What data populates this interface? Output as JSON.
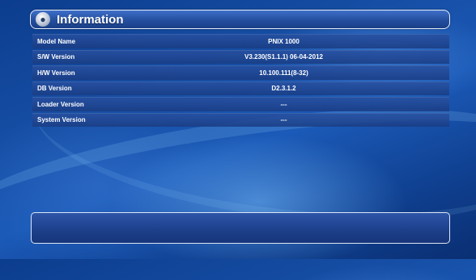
{
  "header": {
    "title": "Information",
    "icon": "info-person-icon"
  },
  "info_rows": [
    {
      "label": "Model Name",
      "value": "PNIX 1000"
    },
    {
      "label": "S/W Version",
      "value": "V3.230(S1.1.1)  06-04-2012"
    },
    {
      "label": "H/W Version",
      "value": "10.100.111(8-32)"
    },
    {
      "label": "DB Version",
      "value": "D2.3.1.2"
    },
    {
      "label": "Loader Version",
      "value": "---"
    },
    {
      "label": "System Version",
      "value": "---"
    }
  ],
  "colors": {
    "background": "#164fa6",
    "row": "#244f9f",
    "text": "#ffffff"
  }
}
